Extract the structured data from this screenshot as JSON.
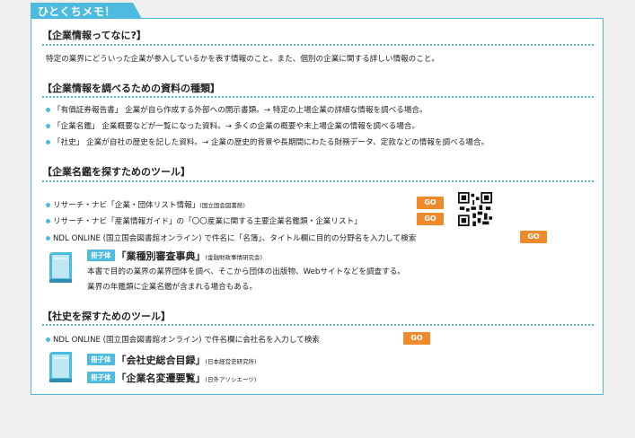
{
  "tab_label": "ひとくちメモ！",
  "sections": [
    {
      "heading": "【企業情報ってなに?】",
      "body": "特定の業界にどういった企業が参入しているかを表す情報のこと。また、個別の企業に関する詳しい情報のこと。"
    },
    {
      "heading": "【企業情報を調べるための資料の種類】",
      "items": [
        "「有価証券報告書」 企業が自ら作成する外部への開示書類。→ 特定の上場企業の詳細な情報を調べる場合。",
        "「企業名鑑」 企業概要などが一覧になった資料。→ 多くの企業の概要や未上場企業の情報を調べる場合。",
        "「社史」 企業が自社の歴史を記した資料。→ 企業の歴史的背景や長期間にわたる財務データ、定款などの情報を調べる場合。"
      ]
    },
    {
      "heading": "【企業名鑑を探すためのツール】",
      "items": [
        {
          "text": "リサーチ・ナビ「企業・団体リスト情報」",
          "small": "(国立国会図書館)"
        },
        {
          "text": "リサーチ・ナビ「産業情報ガイド」の「〇〇産業に関する主要企業名鑑類・企業リスト」"
        },
        {
          "text": "NDL ONLINE (国立国会図書館オンライン) で件名に「名簿」、タイトル欄に目的の分野名を入力して検索"
        }
      ],
      "book": {
        "badge": "冊子体",
        "title": "「業種別審査事典」",
        "publisher": "(金融財政事情研究会)",
        "desc1": "本書で目的の業界の業界団体を調べ、そこから団体の出版物、Webサイトなどを調査する。",
        "desc2": "業界の年鑑類に企業名鑑が含まれる場合もある。"
      }
    },
    {
      "heading": "【社史を探すためのツール】",
      "items": [
        {
          "text": "NDL ONLINE (国立国会図書館オンライン) で件名欄に会社名を入力して検索"
        }
      ],
      "books": [
        {
          "badge": "冊子体",
          "title": "「会社史総合目録」",
          "publisher": "(日本経営史研究所)"
        },
        {
          "badge": "冊子体",
          "title": "「企業名変遷要覧」",
          "publisher": "(日外アソシエーツ)"
        }
      ]
    }
  ],
  "go_label": "GO",
  "colors": {
    "accent": "#4dbbe0",
    "go": "#ef8a2c"
  },
  "icons": {
    "qr": "qr-code-icon",
    "book": "book-icon"
  }
}
